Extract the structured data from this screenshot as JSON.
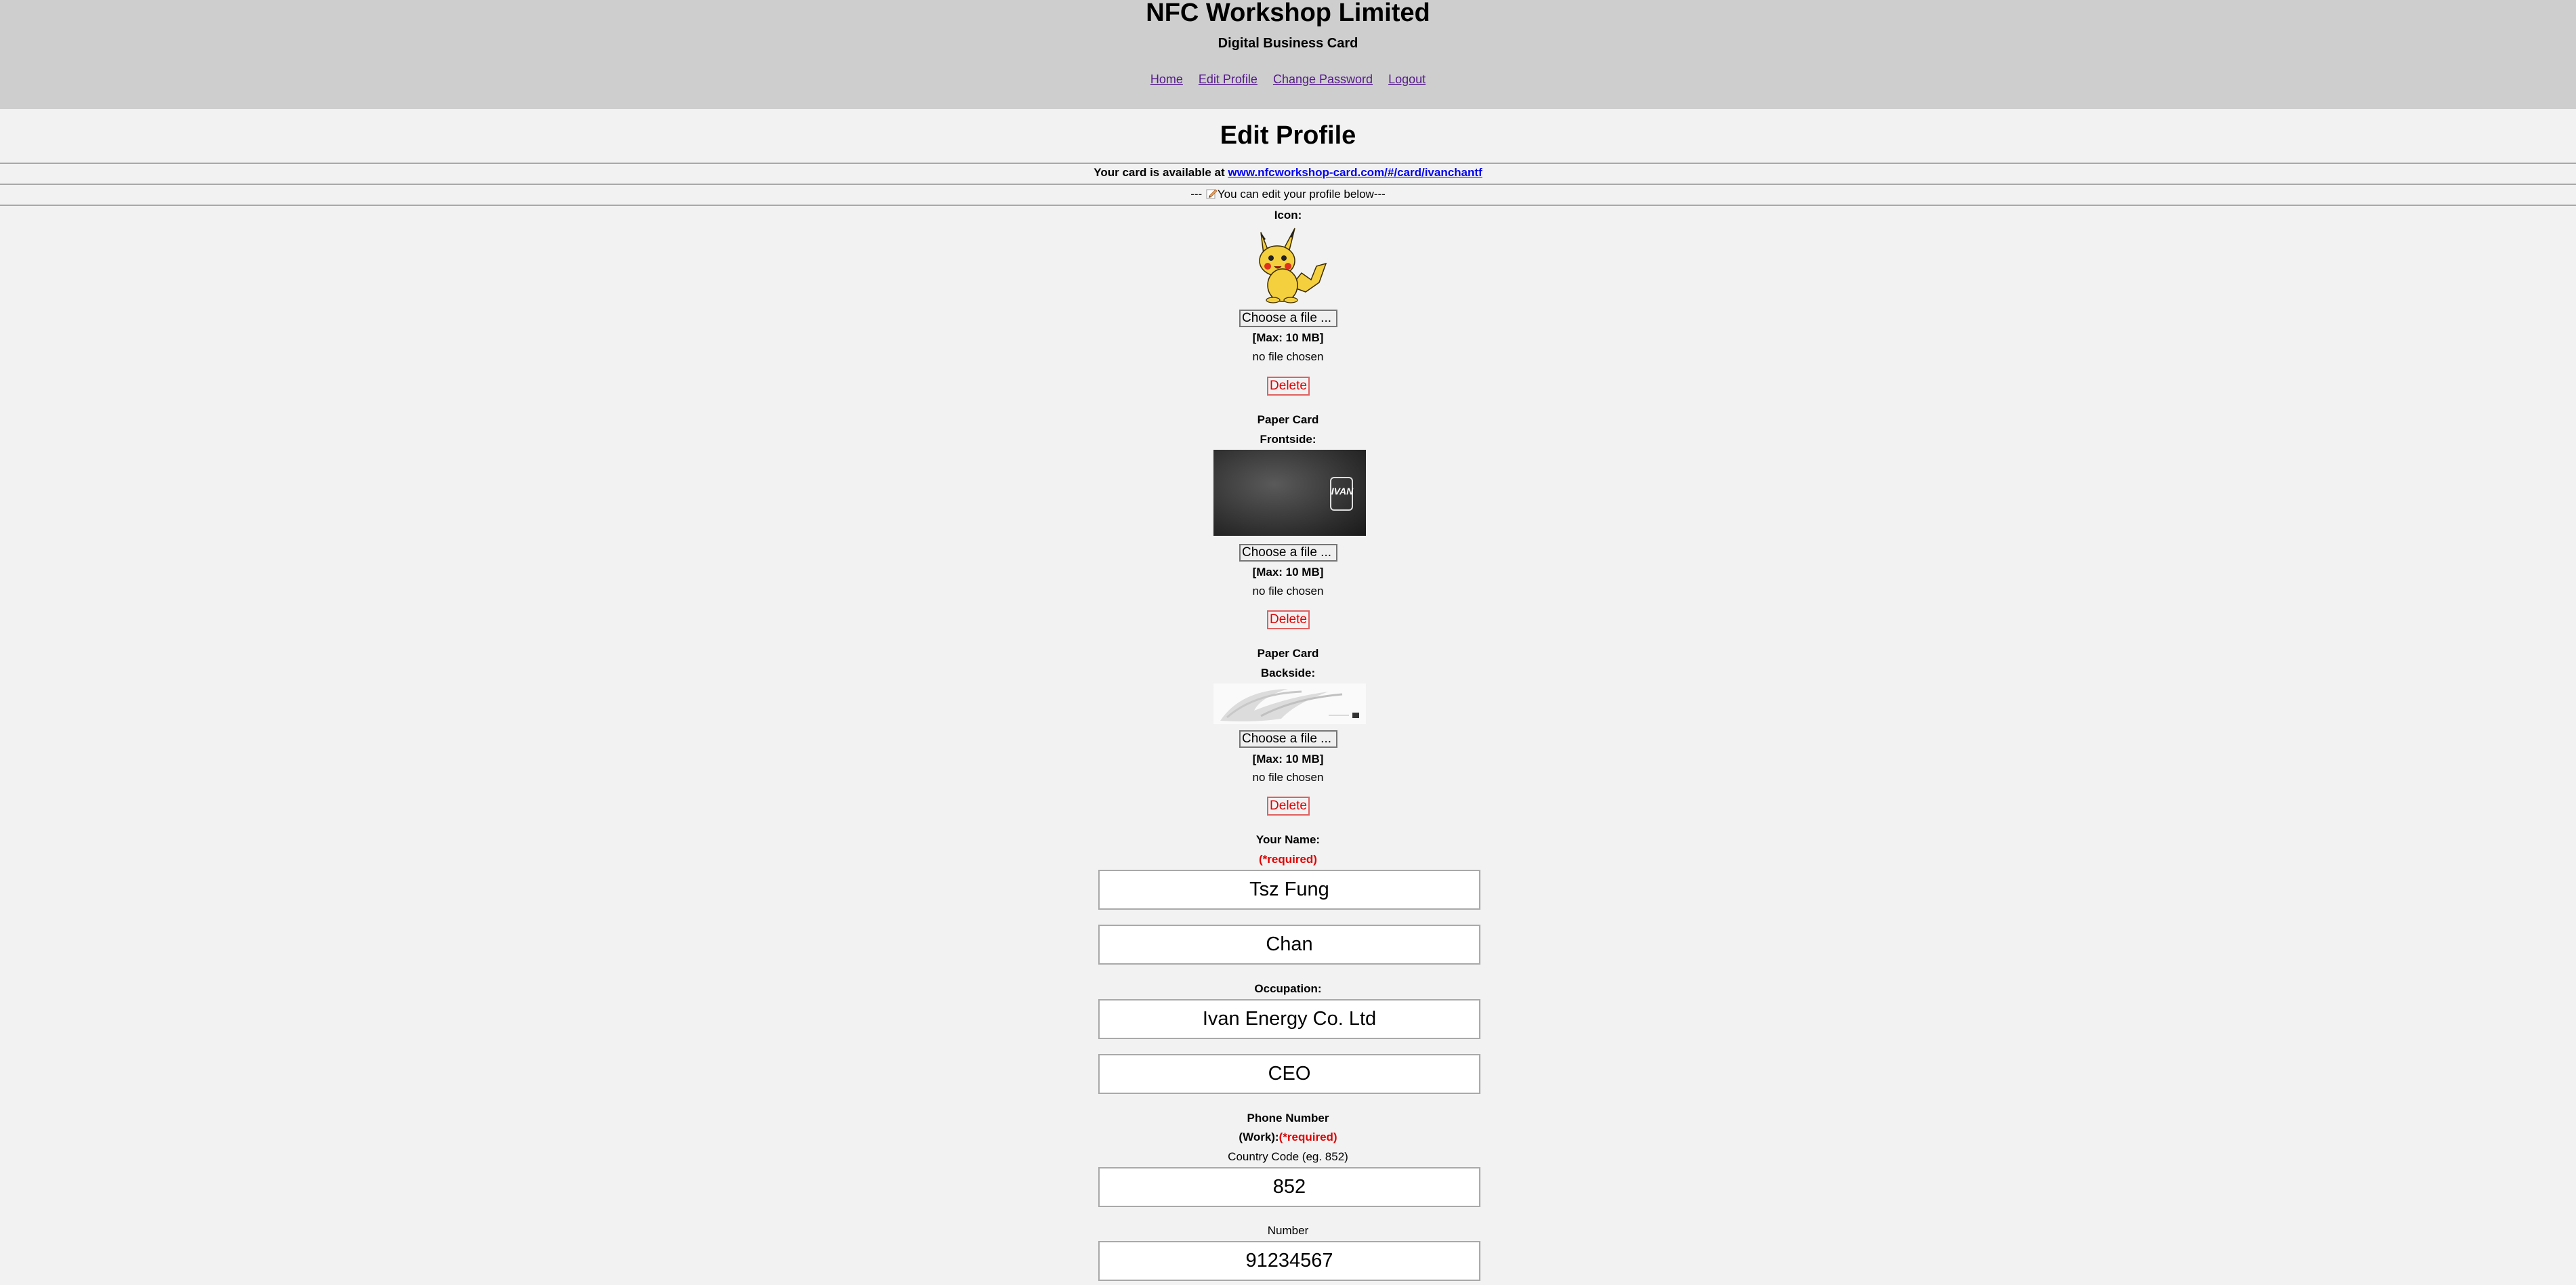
{
  "header": {
    "title": "NFC Workshop Limited",
    "subtitle": "Digital Business Card",
    "nav": [
      "Home",
      "Edit Profile",
      "Change Password",
      "Logout"
    ]
  },
  "page_title": "Edit Profile",
  "card_notice": {
    "prefix": "Your card is available at ",
    "link": "www.nfcworkshop-card.com/#/card/ivanchantf"
  },
  "edit_notice": {
    "before": "--- ",
    "text": "You can edit your profile below---"
  },
  "uploads": {
    "icon": {
      "label": "Icon:",
      "choose": "Choose a file ...",
      "max": "[Max: 10 MB]",
      "status": "no file chosen",
      "delete": "Delete"
    },
    "front": {
      "label1": "Paper Card",
      "label2": "Frontside:",
      "image_text": "IVAN",
      "choose": "Choose a file ...",
      "max": "[Max: 10 MB]",
      "status": "no file chosen",
      "delete": "Delete"
    },
    "back": {
      "label1": "Paper Card",
      "label2": "Backside:",
      "choose": "Choose a file ...",
      "max": "[Max: 10 MB]",
      "status": "no file chosen",
      "delete": "Delete"
    }
  },
  "form": {
    "name_label": "Your Name:",
    "required": "(*required)",
    "first_name": "Tsz Fung",
    "last_name": "Chan",
    "occupation_label": "Occupation:",
    "company": "Ivan Energy Co. Ltd",
    "title": "CEO",
    "phone_label_1": "Phone Number",
    "phone_label_2": "(Work):",
    "country_code_label": "Country Code (eg. 852)",
    "country_code": "852",
    "number_label": "Number",
    "number": "91234567"
  },
  "colors": {
    "header_bg": "#cecece",
    "page_bg": "#f2f2f2",
    "required": "#e00000",
    "link": "#0000ee",
    "nav_link": "#551a8b"
  }
}
